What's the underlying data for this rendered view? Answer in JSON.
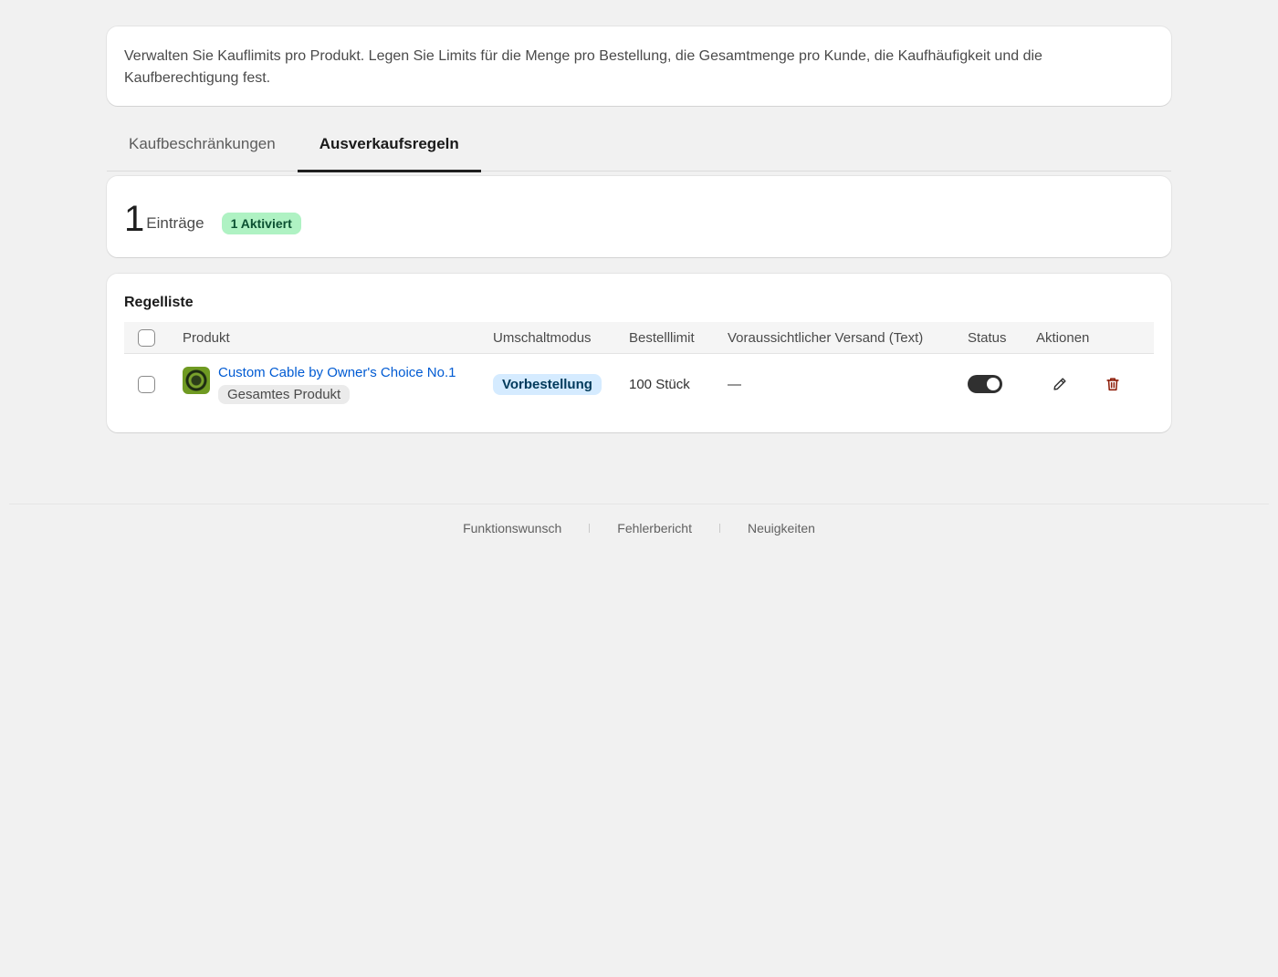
{
  "intro": {
    "text": "Verwalten Sie Kauflimits pro Produkt. Legen Sie Limits für die Menge pro Bestellung, die Gesamtmenge pro Kunde, die Kaufhäufigkeit und die Kaufberechtigung fest."
  },
  "tabs": [
    {
      "label": "Kaufbeschränkungen",
      "active": false
    },
    {
      "label": "Ausverkaufsregeln",
      "active": true
    }
  ],
  "summary": {
    "count": "1",
    "count_label": "Einträge",
    "active_badge": "1 Aktiviert"
  },
  "rules": {
    "title": "Regelliste",
    "columns": {
      "product": "Produkt",
      "mode": "Umschaltmodus",
      "limit": "Bestelllimit",
      "shipping": "Voraussichtlicher Versand (Text)",
      "status": "Status",
      "actions": "Aktionen"
    },
    "rows": [
      {
        "product_name": "Custom Cable by Owner's Choice No.1",
        "scope": "Gesamtes Produkt",
        "mode": "Vorbestellung",
        "limit": "100 Stück",
        "shipping": "—",
        "status_enabled": true
      }
    ]
  },
  "footer": {
    "links": [
      "Funktionswunsch",
      "Fehlerbericht",
      "Neuigkeiten"
    ]
  },
  "colors": {
    "link": "#005bd3",
    "badge_green_bg": "#aff2c3",
    "mode_badge_bg": "#d5ebff",
    "delete_icon": "#8e1f0b",
    "toggle_on": "#303030"
  },
  "icons": {
    "edit": "pencil-icon",
    "delete": "trash-icon"
  }
}
